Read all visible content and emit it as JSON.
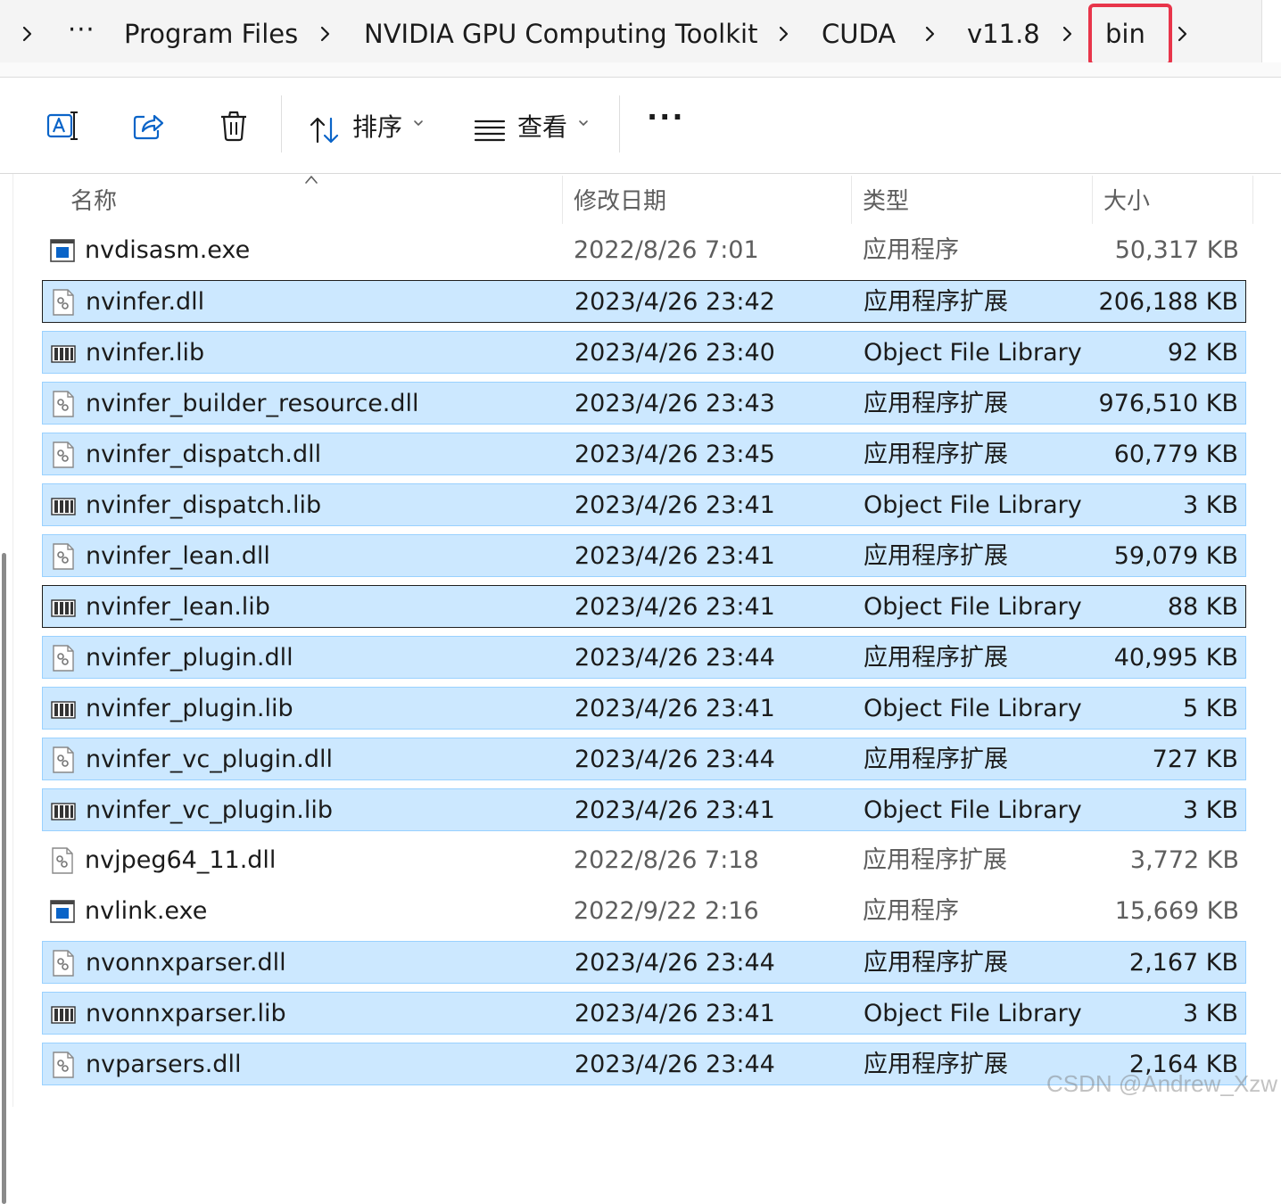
{
  "breadcrumb": {
    "overflow": "···",
    "items": [
      "Program Files",
      "NVIDIA GPU Computing Toolkit",
      "CUDA",
      "v11.8",
      "bin"
    ],
    "highlight_color": "#e8354a"
  },
  "toolbar": {
    "rename_icon": "rename-icon",
    "share_icon": "share-icon",
    "delete_icon": "trash-icon",
    "sort_label": "排序",
    "view_label": "查看",
    "more_label": "···"
  },
  "columns": {
    "name": "名称",
    "date": "修改日期",
    "type": "类型",
    "size": "大小"
  },
  "files": [
    {
      "name": "nvdisasm.exe",
      "date": "2022/8/26 7:01",
      "type": "应用程序",
      "size": "50,317 KB",
      "icon": "exe",
      "selected": false
    },
    {
      "name": "nvinfer.dll",
      "date": "2023/4/26 23:42",
      "type": "应用程序扩展",
      "size": "206,188 KB",
      "icon": "dll",
      "selected": true
    },
    {
      "name": "nvinfer.lib",
      "date": "2023/4/26 23:40",
      "type": "Object File Library",
      "size": "92 KB",
      "icon": "lib",
      "selected": true
    },
    {
      "name": "nvinfer_builder_resource.dll",
      "date": "2023/4/26 23:43",
      "type": "应用程序扩展",
      "size": "976,510 KB",
      "icon": "dll",
      "selected": true
    },
    {
      "name": "nvinfer_dispatch.dll",
      "date": "2023/4/26 23:45",
      "type": "应用程序扩展",
      "size": "60,779 KB",
      "icon": "dll",
      "selected": true
    },
    {
      "name": "nvinfer_dispatch.lib",
      "date": "2023/4/26 23:41",
      "type": "Object File Library",
      "size": "3 KB",
      "icon": "lib",
      "selected": true
    },
    {
      "name": "nvinfer_lean.dll",
      "date": "2023/4/26 23:41",
      "type": "应用程序扩展",
      "size": "59,079 KB",
      "icon": "dll",
      "selected": true
    },
    {
      "name": "nvinfer_lean.lib",
      "date": "2023/4/26 23:41",
      "type": "Object File Library",
      "size": "88 KB",
      "icon": "lib",
      "selected": true
    },
    {
      "name": "nvinfer_plugin.dll",
      "date": "2023/4/26 23:44",
      "type": "应用程序扩展",
      "size": "40,995 KB",
      "icon": "dll",
      "selected": true
    },
    {
      "name": "nvinfer_plugin.lib",
      "date": "2023/4/26 23:41",
      "type": "Object File Library",
      "size": "5 KB",
      "icon": "lib",
      "selected": true
    },
    {
      "name": "nvinfer_vc_plugin.dll",
      "date": "2023/4/26 23:44",
      "type": "应用程序扩展",
      "size": "727 KB",
      "icon": "dll",
      "selected": true
    },
    {
      "name": "nvinfer_vc_plugin.lib",
      "date": "2023/4/26 23:41",
      "type": "Object File Library",
      "size": "3 KB",
      "icon": "lib",
      "selected": true
    },
    {
      "name": "nvjpeg64_11.dll",
      "date": "2022/8/26 7:18",
      "type": "应用程序扩展",
      "size": "3,772 KB",
      "icon": "dll",
      "selected": false
    },
    {
      "name": "nvlink.exe",
      "date": "2022/9/22 2:16",
      "type": "应用程序",
      "size": "15,669 KB",
      "icon": "exe",
      "selected": false
    },
    {
      "name": "nvonnxparser.dll",
      "date": "2023/4/26 23:44",
      "type": "应用程序扩展",
      "size": "2,167 KB",
      "icon": "dll",
      "selected": true
    },
    {
      "name": "nvonnxparser.lib",
      "date": "2023/4/26 23:41",
      "type": "Object File Library",
      "size": "3 KB",
      "icon": "lib",
      "selected": true
    },
    {
      "name": "nvparsers.dll",
      "date": "2023/4/26 23:44",
      "type": "应用程序扩展",
      "size": "2,164 KB",
      "icon": "dll",
      "selected": true
    }
  ],
  "watermark": "CSDN @Andrew_Xzw",
  "colors": {
    "selection_bg": "#cce8ff",
    "selection_border": "#99d1ff",
    "accent_blue": "#0a64c8"
  }
}
